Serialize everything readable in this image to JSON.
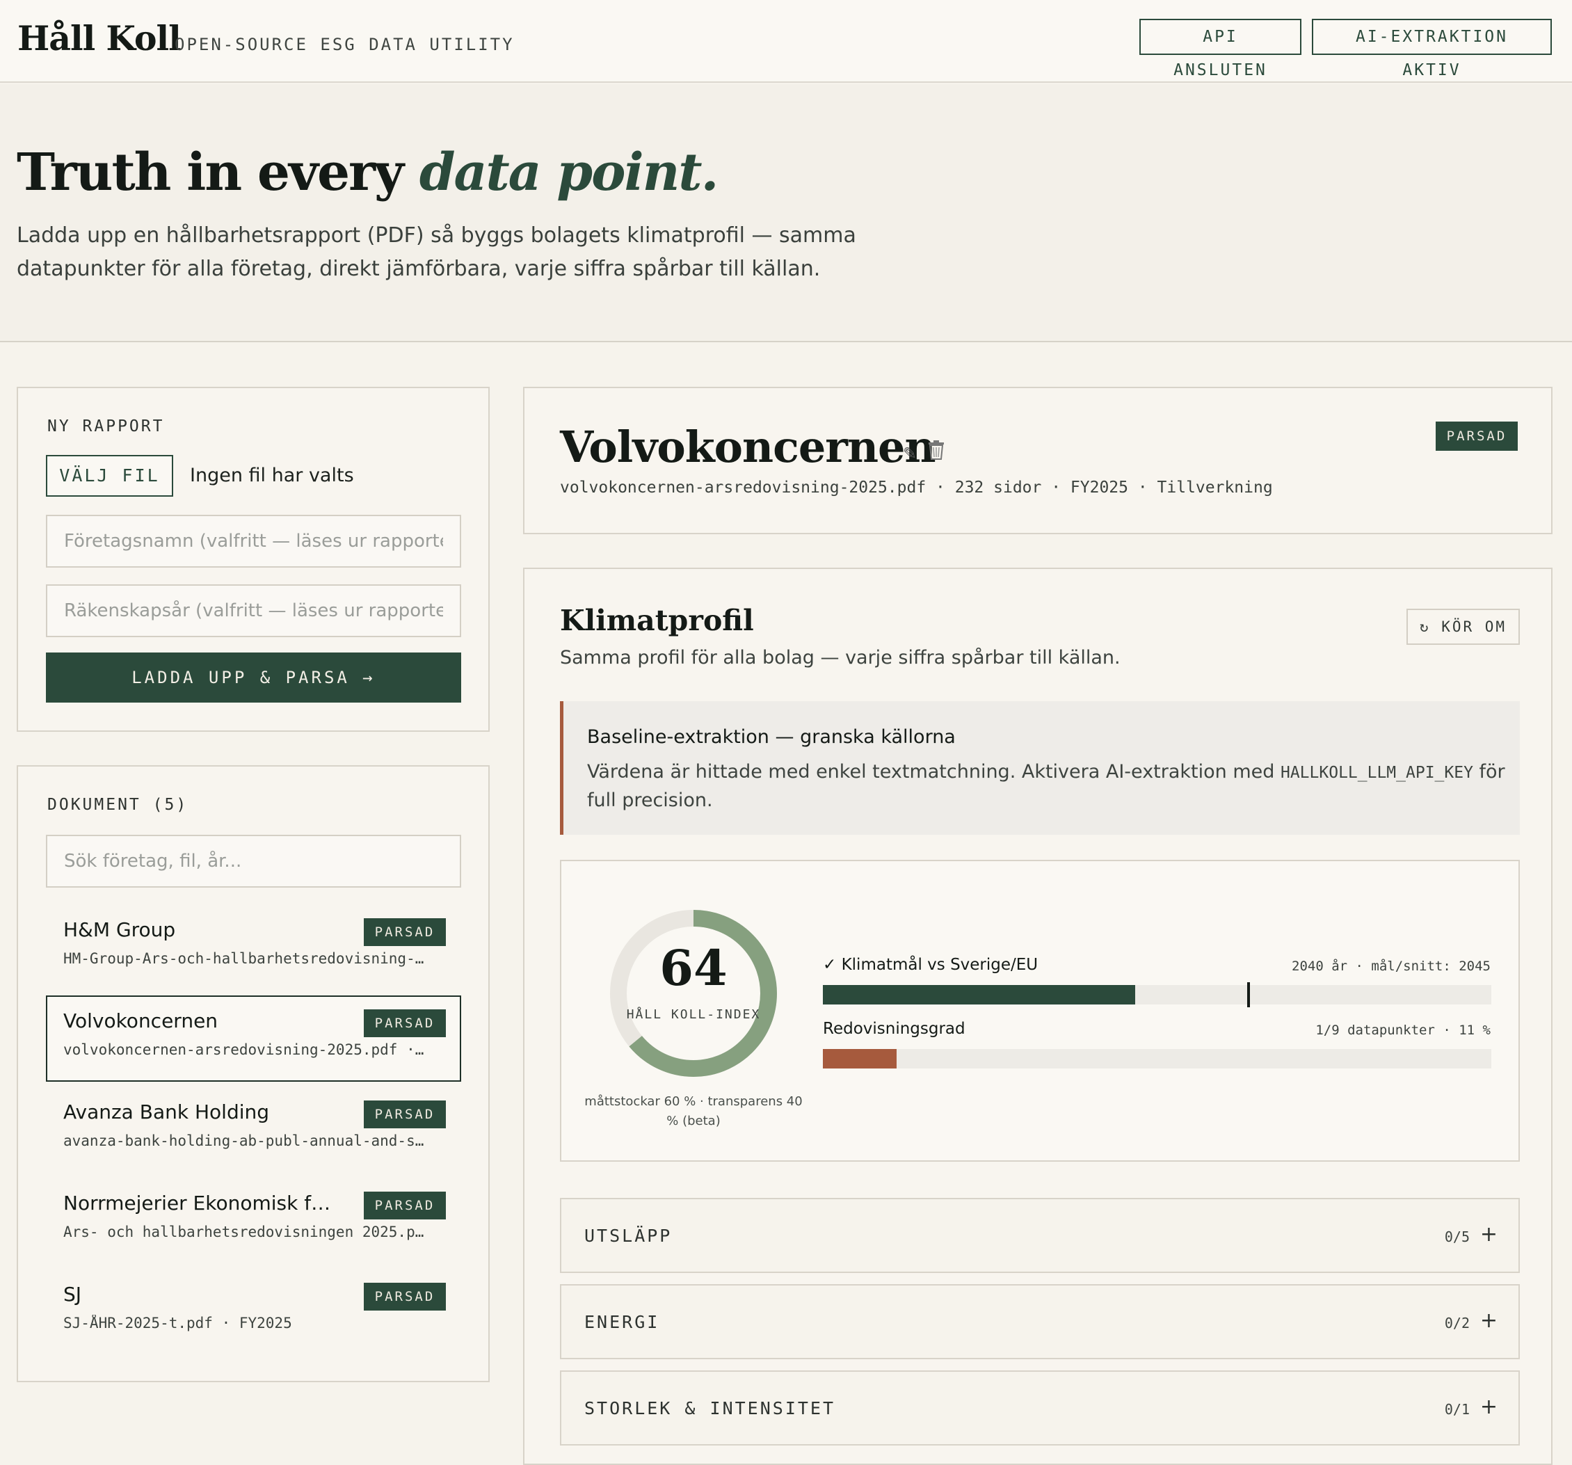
{
  "app": {
    "brand": "Håll Koll",
    "tagline": "OPEN-SOURCE ESG DATA UTILITY",
    "status_badges": [
      "API ANSLUTEN",
      "AI-EXTRAKTION AKTIV"
    ]
  },
  "hero": {
    "title_plain": "Truth in every",
    "title_accent": "data point.",
    "description": "Ladda upp en hållbarhetsrapport (PDF) så byggs bolagets klimatprofil — samma datapunkter för alla företag, direkt jämförbara, varje siffra spårbar till källan."
  },
  "upload": {
    "label": "NY RAPPORT",
    "file_button": "VÄLJ FIL",
    "file_status": "Ingen fil har valts",
    "company_placeholder": "Företagsnamn (valfritt — läses ur rapporten)",
    "year_placeholder": "Räkenskapsår (valfritt — läses ur rapporten)",
    "submit_label": "LADDA UPP & PARSA →"
  },
  "documents": {
    "label": "DOKUMENT (5)",
    "search_placeholder": "Sök företag, fil, år...",
    "items": [
      {
        "name": "H&M Group",
        "file": "HM-Group-Ars-och-hallbarhetsredovisning-…",
        "status": "PARSAD"
      },
      {
        "name": "Volvokoncernen",
        "file": "volvokoncernen-arsredovisning-2025.pdf ·…",
        "status": "PARSAD"
      },
      {
        "name": "Avanza Bank Holding",
        "file": "avanza-bank-holding-ab-publ-annual-and-s…",
        "status": "PARSAD"
      },
      {
        "name": "Norrmejerier Ekonomisk föreni…",
        "file": "Ars- och hallbarhetsredovisningen 2025.p…",
        "status": "PARSAD"
      },
      {
        "name": "SJ",
        "file": "SJ-ÅHR-2025-t.pdf · FY2025",
        "status": "PARSAD"
      }
    ]
  },
  "company": {
    "name": "Volvokoncernen",
    "status": "PARSAD",
    "meta": "volvokoncernen-arsredovisning-2025.pdf · 232 sidor · FY2025 · Tillverkning",
    "edit_icon": "pencil-icon",
    "delete_icon": "trash-icon"
  },
  "profile": {
    "title": "Klimatprofil",
    "subtitle": "Samma profil för alla bolag — varje siffra spårbar till källan.",
    "rerun_label": "↻ KÖR OM",
    "notice": {
      "title": "Baseline-extraktion — granska källorna",
      "body_pre": "Värdena är hittade med enkel textmatchning. Aktivera AI-extraktion med ",
      "code": "HALLKOLL_LLM_API_KEY",
      "body_post": " för full precision."
    },
    "score": {
      "value": "64",
      "fraction": 0.64,
      "label": "HÅLL KOLL-INDEX",
      "note": "måttstockar 60 % · transparens 40 % (beta)"
    },
    "metrics": [
      {
        "label": "✓ Klimatmål vs Sverige/EU",
        "detail": "2040 år · mål/snitt: 2045",
        "fill": 0.467,
        "marker": 0.635,
        "color": "#2b4a3b"
      },
      {
        "label": "Redovisningsgrad",
        "detail": "1/9 datapunkter · 11 %",
        "fill": 0.11,
        "color": "#a65a3d"
      }
    ],
    "sections": [
      {
        "title": "UTSLÄPP",
        "count": "0/5"
      },
      {
        "title": "ENERGI",
        "count": "0/2"
      },
      {
        "title": "STORLEK & INTENSITET",
        "count": "0/1"
      }
    ]
  },
  "colors": {
    "accent": "#2b4a3b",
    "warning": "#a65a3d",
    "gauge_track": "#e9e6e0",
    "gauge_fill": "#86a07f"
  }
}
